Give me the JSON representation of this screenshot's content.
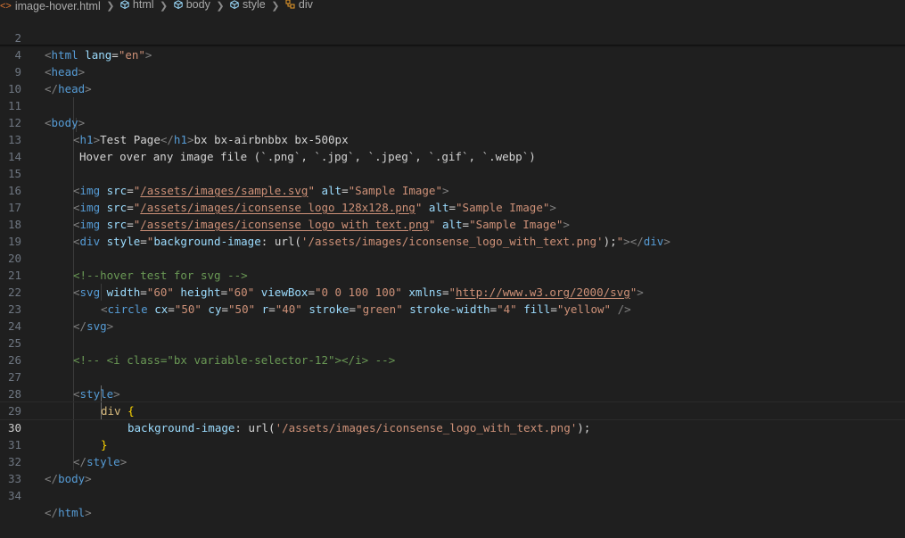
{
  "breadcrumb": {
    "file": "image-hover.html",
    "path": [
      "html",
      "body",
      "style",
      "div"
    ]
  },
  "editor": {
    "active_line": "30",
    "lines": [
      {
        "n": "2"
      },
      {
        "n": "4"
      },
      {
        "n": "9"
      },
      {
        "n": "10"
      },
      {
        "n": "11"
      },
      {
        "n": "12"
      },
      {
        "n": "13"
      },
      {
        "n": "14"
      },
      {
        "n": "15"
      },
      {
        "n": "16"
      },
      {
        "n": "17"
      },
      {
        "n": "18"
      },
      {
        "n": "19"
      },
      {
        "n": "20"
      },
      {
        "n": "21"
      },
      {
        "n": "22"
      },
      {
        "n": "23"
      },
      {
        "n": "24"
      },
      {
        "n": "25"
      },
      {
        "n": "26"
      },
      {
        "n": "27"
      },
      {
        "n": "28"
      },
      {
        "n": "29"
      },
      {
        "n": "30"
      },
      {
        "n": "31"
      },
      {
        "n": "32"
      },
      {
        "n": "33"
      },
      {
        "n": "34"
      }
    ],
    "tokens": {
      "t2a": "<",
      "t2b": "html",
      "t2c": " ",
      "t2d": "lang",
      "t2e": "=",
      "t2f": "\"en\"",
      "t2g": ">",
      "t4a": "<",
      "t4b": "head",
      "t4c": ">",
      "t9a": "</",
      "t9b": "head",
      "t9c": ">",
      "t11a": "<",
      "t11b": "body",
      "t11c": ">",
      "t12a": "<",
      "t12b": "h1",
      "t12c": ">",
      "t12d": "Test Page",
      "t12e": "</",
      "t12f": "h1",
      "t12g": ">",
      "t12h": "bx bx-airbnbbx bx-500px",
      "t13a": "Hover over any image file (`.png`, `.jpg`, `.jpeg`, `.gif`, `.webp`)",
      "t15a": "<",
      "t15b": "img",
      "t15c": " src",
      "t15d": "=",
      "t15e": "\"",
      "t15f": "/assets/images/sample.svg",
      "t15g": "\"",
      "t15h": " alt",
      "t15i": "=",
      "t15j": "\"Sample Image\"",
      "t15k": ">",
      "t16a": "<",
      "t16b": "img",
      "t16c": " src",
      "t16d": "=",
      "t16e": "\"",
      "t16f": "/assets/images/iconsense_logo_128x128.png",
      "t16g": "\"",
      "t16h": " alt",
      "t16i": "=",
      "t16j": "\"Sample Image\"",
      "t16k": ">",
      "t17a": "<",
      "t17b": "img",
      "t17c": " src",
      "t17d": "=",
      "t17e": "\"",
      "t17f": "/assets/images/iconsense_logo_with_text.png",
      "t17g": "\"",
      "t17h": " alt",
      "t17i": "=",
      "t17j": "\"Sample Image\"",
      "t17k": ">",
      "t18a": "<",
      "t18b": "div",
      "t18c": " style",
      "t18d": "=",
      "t18e": "\"",
      "t18f": "background-image",
      "t18g": ": ",
      "t18h": "url(",
      "t18i": "'/assets/images/iconsense_logo_with_text.png'",
      "t18j": ");",
      "t18k": "\"",
      "t18l": "></",
      "t18m": "div",
      "t18n": ">",
      "t20a": "<!--hover test for svg -->",
      "t21a": "<",
      "t21b": "svg",
      "t21c": " width",
      "t21d": "=",
      "t21e": "\"60\"",
      "t21f": " height",
      "t21g": "=",
      "t21h": "\"60\"",
      "t21i": " viewBox",
      "t21j": "=",
      "t21k": "\"0 0 100 100\"",
      "t21l": " xmlns",
      "t21m": "=",
      "t21n": "\"",
      "t21o": "http://www.w3.org/2000/svg",
      "t21p": "\"",
      "t21q": ">",
      "t22a": "<",
      "t22b": "circle",
      "t22c": " cx",
      "t22d": "=",
      "t22e": "\"50\"",
      "t22f": " cy",
      "t22g": "=",
      "t22h": "\"50\"",
      "t22i": " r",
      "t22j": "=",
      "t22k": "\"40\"",
      "t22l": " stroke",
      "t22m": "=",
      "t22n": "\"green\"",
      "t22o": " stroke-width",
      "t22p": "=",
      "t22q": "\"4\"",
      "t22r": " fill",
      "t22s": "=",
      "t22t": "\"yellow\"",
      "t22u": " />",
      "t23a": "</",
      "t23b": "svg",
      "t23c": ">",
      "t25a": "<!-- <i class=\"bx variable-selector-12\"></i> -->",
      "t27a": "<",
      "t27b": "style",
      "t27c": ">",
      "t28a": "div",
      "t28b": " {",
      "t29a": "background-image",
      "t29b": ": ",
      "t29c": "url(",
      "t29d": "'/assets/images/iconsense_logo_with_text.png'",
      "t29e": ");",
      "t30a": "}",
      "t31a": "</",
      "t31b": "style",
      "t31c": ">",
      "t32a": "</",
      "t32b": "body",
      "t32c": ">",
      "t34a": "</",
      "t34b": "html",
      "t34c": ">"
    }
  },
  "colors": {
    "background": "#1f1f1f",
    "tag": "#569cd6",
    "attribute": "#9cdcfe",
    "string": "#ce9178",
    "comment": "#6a9955",
    "selector": "#d7ba7d",
    "brace": "#ffd700",
    "line_number": "#6e7681"
  }
}
